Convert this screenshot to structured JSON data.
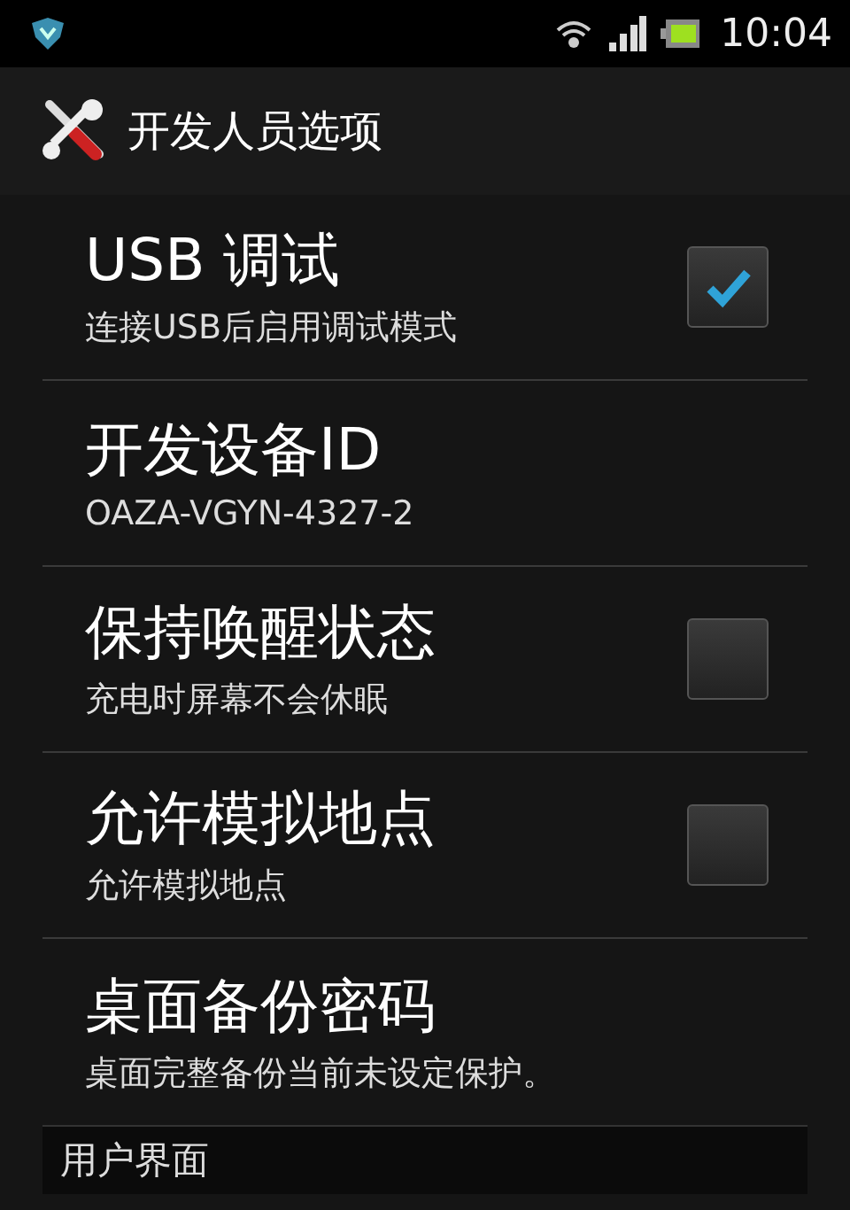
{
  "status_bar": {
    "time": "10:04"
  },
  "header": {
    "title": "开发人员选项"
  },
  "items": [
    {
      "kind": "checkbox",
      "title": "USB 调试",
      "summary": "连接USB后启用调试模式",
      "checked": true
    },
    {
      "kind": "text",
      "title": "开发设备ID",
      "summary": "OAZA-VGYN-4327-2"
    },
    {
      "kind": "checkbox",
      "title": "保持唤醒状态",
      "summary": "充电时屏幕不会休眠",
      "checked": false
    },
    {
      "kind": "checkbox",
      "title": "允许模拟地点",
      "summary": "允许模拟地点",
      "checked": false
    },
    {
      "kind": "text",
      "title": "桌面备份密码",
      "summary": "桌面完整备份当前未设定保护。"
    }
  ],
  "section": {
    "title": "用户界面"
  }
}
